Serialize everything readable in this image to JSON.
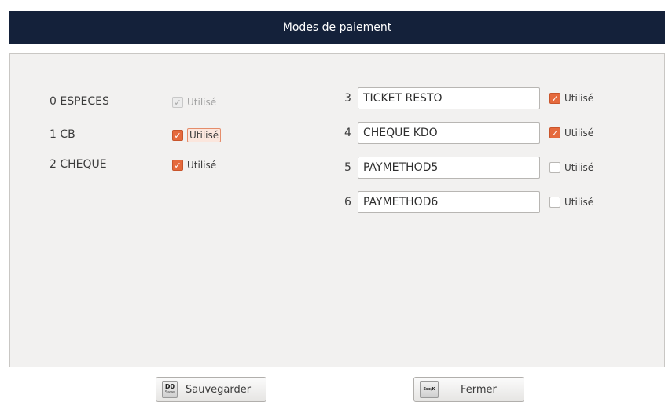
{
  "window": {
    "title": "Modes de paiement"
  },
  "fixed_methods": [
    {
      "index": "0",
      "name": "ESPECES",
      "used_label": "Utilisé",
      "checked": true,
      "disabled": true
    },
    {
      "index": "1",
      "name": "CB",
      "used_label": "Utilisé",
      "checked": true,
      "disabled": false,
      "focused": true
    },
    {
      "index": "2",
      "name": "CHEQUE",
      "used_label": "Utilisé",
      "checked": true,
      "disabled": false
    }
  ],
  "custom_methods": [
    {
      "index": "3",
      "value": "TICKET RESTO",
      "used_label": "Utilisé",
      "checked": true
    },
    {
      "index": "4",
      "value": "CHEQUE KDO",
      "used_label": "Utilisé",
      "checked": true
    },
    {
      "index": "5",
      "value": "PAYMETHOD5",
      "used_label": "Utilisé",
      "checked": false
    },
    {
      "index": "6",
      "value": "PAYMETHOD6",
      "used_label": "Utilisé",
      "checked": false
    }
  ],
  "buttons": {
    "save": {
      "label": "Sauvegarder",
      "key": "D0",
      "key_sub": "Save"
    },
    "close": {
      "label": "Fermer",
      "key": "Esc/K"
    }
  },
  "colors": {
    "titlebar": "#14213a",
    "accent_checkbox": "#e56a3d",
    "panel_bg": "#f2f1f0"
  },
  "icons": {
    "checked": "check-mark-icon"
  }
}
